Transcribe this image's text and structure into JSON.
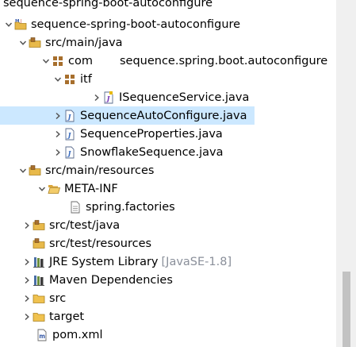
{
  "tree": {
    "clipped_top_item": "sequence-spring-boot-autoconfigure",
    "project": "sequence-spring-boot-autoconfigure",
    "src_main_java": "src/main/java",
    "pkg_com": "com",
    "pkg_com_suffix": "sequence.spring.boot.autoconfigure",
    "pkg_itf": "itf",
    "file_isequenceservice": "ISequenceService.java",
    "file_sequenceautoconfigure": "SequenceAutoConfigure.java",
    "file_sequenceproperties": "SequenceProperties.java",
    "file_snowflakesequence": "SnowflakeSequence.java",
    "src_main_resources": "src/main/resources",
    "folder_meta_inf": "META-INF",
    "file_spring_factories": "spring.factories",
    "src_test_java": "src/test/java",
    "src_test_resources": "src/test/resources",
    "jre_library": "JRE System Library",
    "jre_library_decoration": "[JavaSE-1.8]",
    "maven_dependencies": "Maven Dependencies",
    "folder_src": "src",
    "folder_target": "target",
    "file_pom": "pom.xml"
  },
  "selected_item": "SequenceAutoConfigure.java",
  "scrollbar": {
    "position_fraction": 0.78
  },
  "colors": {
    "selection": "#cce8ff",
    "decoration": "#8a8f9a",
    "folder": "#e8b94a",
    "package": "#a76f2d",
    "java_file": "#3d6ebf"
  }
}
